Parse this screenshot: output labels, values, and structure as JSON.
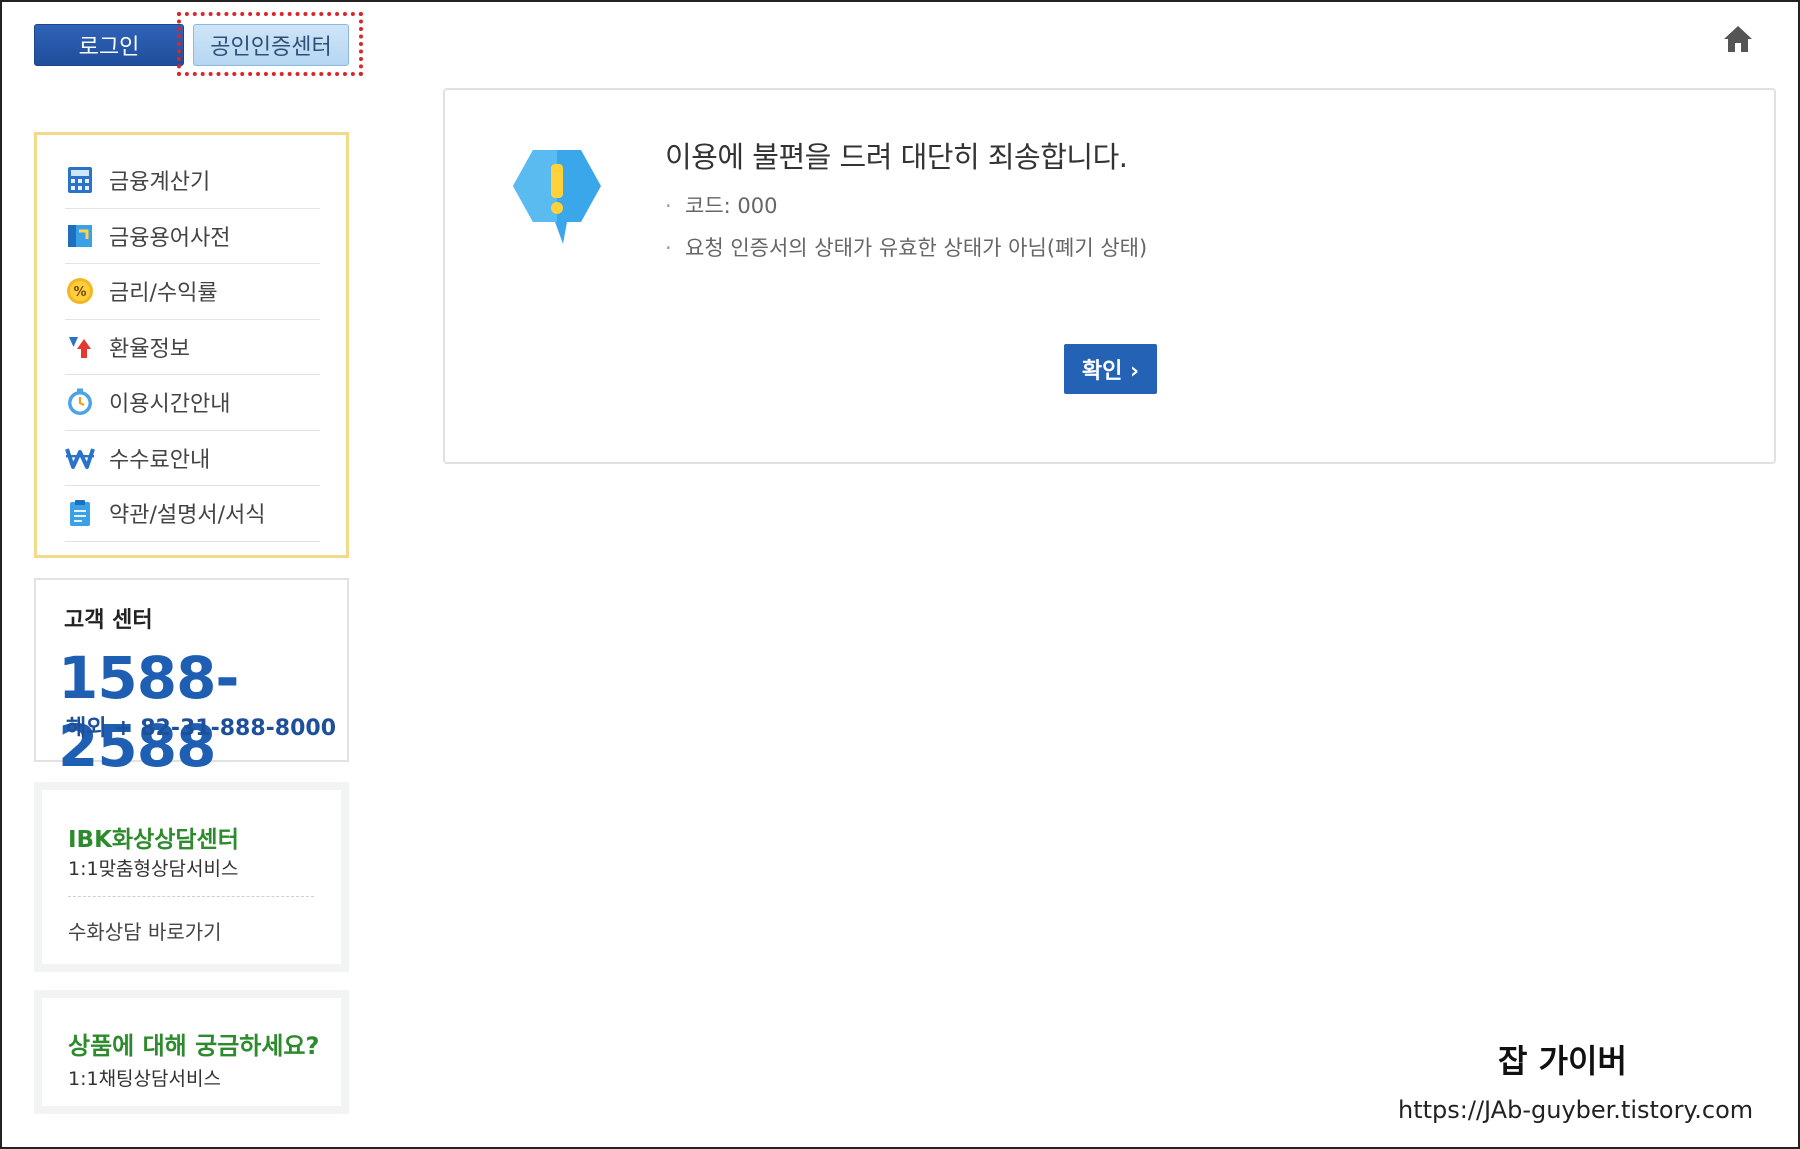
{
  "header": {
    "login_label": "로그인",
    "cert_center_label": "공인인증센터",
    "home_icon": "home-icon"
  },
  "sidebar": {
    "menu": [
      {
        "label": "금융계산기",
        "icon": "calculator-icon"
      },
      {
        "label": "금융용어사전",
        "icon": "dictionary-icon"
      },
      {
        "label": "금리/수익률",
        "icon": "percent-icon"
      },
      {
        "label": "환율정보",
        "icon": "exchange-rate-icon"
      },
      {
        "label": "이용시간안내",
        "icon": "clock-icon"
      },
      {
        "label": "수수료안내",
        "icon": "won-icon"
      },
      {
        "label": "약관/설명서/서식",
        "icon": "document-icon"
      }
    ],
    "customer_center": {
      "title": "고객 센터",
      "phone": "1588-2588",
      "overseas": "해외 + 82-31-888-8000"
    },
    "ibk": {
      "title": "IBK화상상담센터",
      "subtitle": "1:1맞춤형상담서비스",
      "link": "수화상담 바로가기"
    },
    "product": {
      "title": "상품에 대해 궁금하세요?",
      "subtitle": "1:1채팅상담서비스"
    }
  },
  "message": {
    "title": "이용에 불편을 드려 대단히 죄송합니다.",
    "code_line": "코드: 000",
    "detail_line": "요청 인증서의 상태가 유효한 상태가 아님(폐기 상태)",
    "bullet": "·",
    "confirm_label": "확인 ›"
  },
  "watermark": {
    "name": "잡 가이버",
    "url": "https://JAb-guyber.tistory.com"
  },
  "colors": {
    "primary": "#2462b5",
    "menu_border": "#f3d98a",
    "green": "#2d8b2d",
    "alert": "#d8262c"
  }
}
